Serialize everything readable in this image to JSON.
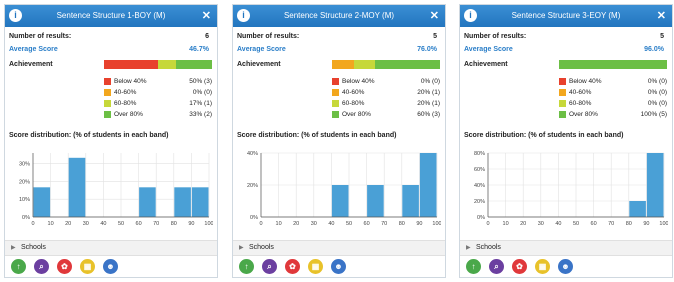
{
  "colors": {
    "header": "#2275bf",
    "bar": "#4aa0d6",
    "below40": "#e8412d",
    "b40_60": "#f2a71e",
    "b60_80": "#c6d83a",
    "over80": "#6cbf45"
  },
  "labels": {
    "results": "Number of results:",
    "average": "Average Score",
    "achievement": "Achievement",
    "distribution": "Score distribution: (% of students in each band)",
    "schools": "Schools"
  },
  "icons": [
    "up-arrow-icon",
    "search-icon",
    "hands-icon",
    "calendar-icon",
    "group-icon"
  ],
  "panels": [
    {
      "title": "Sentence Structure 1-BOY (M)",
      "results": "6",
      "average": "46.7%",
      "achievement": [
        50,
        0,
        17,
        33
      ],
      "legend": [
        {
          "label": "Below 40%",
          "value": "50% (3)"
        },
        {
          "label": "40-60%",
          "value": "0% (0)"
        },
        {
          "label": "60-80%",
          "value": "17% (1)"
        },
        {
          "label": "Over 80%",
          "value": "33% (2)"
        }
      ],
      "chart_data": {
        "type": "bar",
        "x": [
          10,
          30,
          70,
          90,
          100
        ],
        "values": [
          16.7,
          33.3,
          16.7,
          16.7,
          16.7
        ],
        "ylim": [
          0,
          36
        ],
        "yticks": [
          "0%",
          "10%",
          "20%",
          "30%"
        ],
        "ytick_vals": [
          0,
          10,
          20,
          30
        ],
        "xticks": [
          "0",
          "10",
          "20",
          "30",
          "40",
          "50",
          "60",
          "70",
          "80",
          "90",
          "100"
        ]
      }
    },
    {
      "title": "Sentence Structure 2-MOY (M)",
      "results": "5",
      "average": "76.0%",
      "achievement": [
        0,
        20,
        20,
        60
      ],
      "legend": [
        {
          "label": "Below 40%",
          "value": "0% (0)"
        },
        {
          "label": "40-60%",
          "value": "20% (1)"
        },
        {
          "label": "60-80%",
          "value": "20% (1)"
        },
        {
          "label": "Over 80%",
          "value": "60% (3)"
        }
      ],
      "chart_data": {
        "type": "bar",
        "x": [
          50,
          70,
          90,
          100
        ],
        "values": [
          20,
          20,
          20,
          40
        ],
        "ylim": [
          0,
          40
        ],
        "yticks": [
          "0%",
          "20%",
          "40%"
        ],
        "ytick_vals": [
          0,
          20,
          40
        ],
        "xticks": [
          "0",
          "10",
          "20",
          "30",
          "40",
          "50",
          "60",
          "70",
          "80",
          "90",
          "100"
        ]
      }
    },
    {
      "title": "Sentence Structure 3-EOY (M)",
      "results": "5",
      "average": "96.0%",
      "achievement": [
        0,
        0,
        0,
        100
      ],
      "legend": [
        {
          "label": "Below 40%",
          "value": "0% (0)"
        },
        {
          "label": "40-60%",
          "value": "0% (0)"
        },
        {
          "label": "60-80%",
          "value": "0% (0)"
        },
        {
          "label": "Over 80%",
          "value": "100% (5)"
        }
      ],
      "chart_data": {
        "type": "bar",
        "x": [
          90,
          100
        ],
        "values": [
          20,
          80
        ],
        "ylim": [
          0,
          80
        ],
        "yticks": [
          "0%",
          "20%",
          "40%",
          "60%",
          "80%"
        ],
        "ytick_vals": [
          0,
          20,
          40,
          60,
          80
        ],
        "xticks": [
          "0",
          "10",
          "20",
          "30",
          "40",
          "50",
          "60",
          "70",
          "80",
          "90",
          "100"
        ]
      }
    }
  ]
}
